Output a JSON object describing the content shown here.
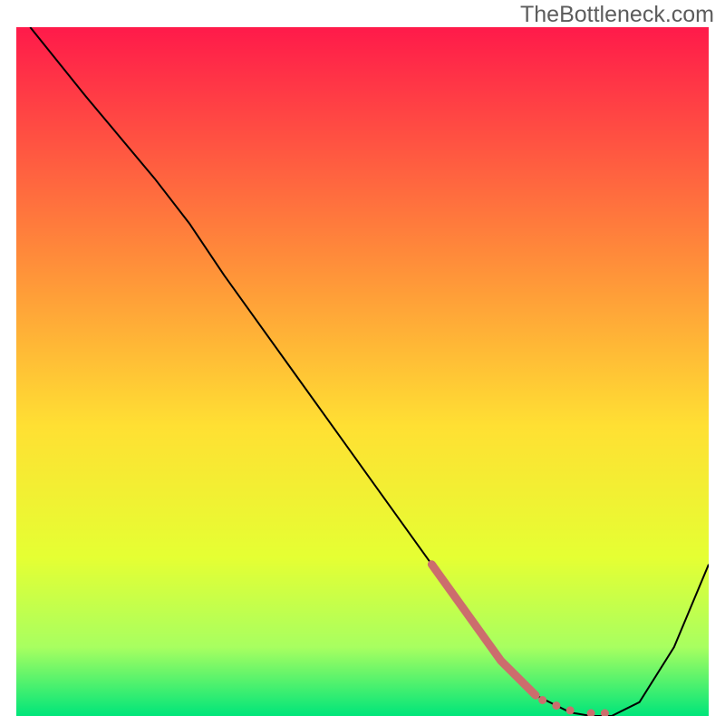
{
  "attribution": "TheBottleneck.com",
  "chart_data": {
    "type": "line",
    "title": "",
    "xlabel": "",
    "ylabel": "",
    "xlim": [
      0,
      100
    ],
    "ylim": [
      0,
      100
    ],
    "gradient_colors": {
      "top": "#ff1a4a",
      "mid_upper": "#ff8a3a",
      "mid": "#ffe033",
      "mid_lower": "#e5ff33",
      "lower": "#a8ff60",
      "bottom": "#00e57a"
    },
    "curve": {
      "name": "bottleneck-curve",
      "color": "#000000",
      "x": [
        2,
        10,
        20,
        25,
        30,
        40,
        50,
        60,
        65,
        70,
        75,
        80,
        83,
        86,
        90,
        95,
        100
      ],
      "y": [
        100,
        90,
        78,
        71.5,
        64,
        50,
        36,
        22,
        15,
        8,
        3,
        0.5,
        0,
        0,
        2,
        10,
        22
      ]
    },
    "highlight": {
      "name": "optimal-region-highlight",
      "color": "#cc6d6d",
      "segment": {
        "x": [
          60,
          70,
          75
        ],
        "y": [
          22,
          8,
          3
        ]
      },
      "dots_x": [
        76,
        78,
        80,
        83,
        85
      ],
      "dots_y": [
        2.3,
        1.5,
        0.8,
        0.4,
        0.4
      ]
    }
  }
}
